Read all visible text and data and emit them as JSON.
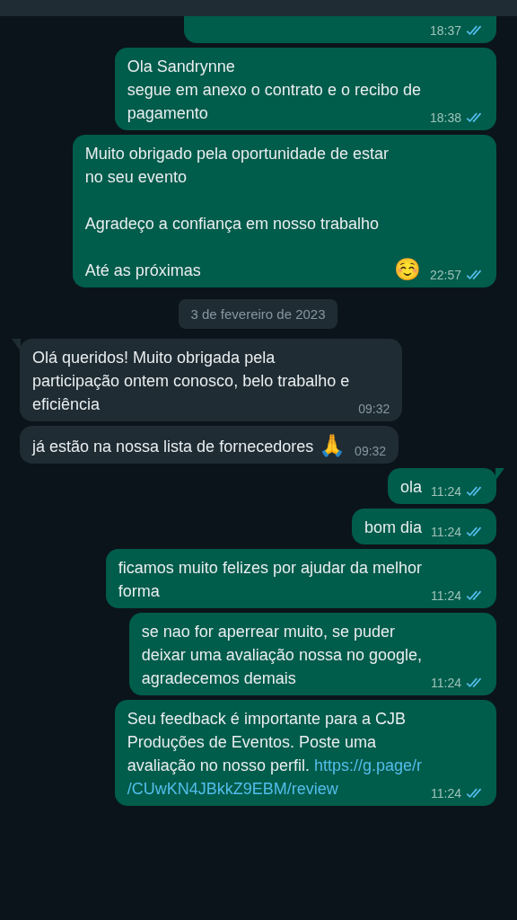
{
  "messages": [
    {
      "kind": "out",
      "time": "18:37",
      "read": true,
      "tail": false,
      "clipped": true
    },
    {
      "kind": "out",
      "text": "Ola Sandrynne\nsegue em anexo o contrato e o recibo de\npagamento",
      "time": "18:38",
      "read": true,
      "tail": false
    },
    {
      "kind": "out",
      "text": "Muito obrigado pela oportunidade de estar\nno seu evento\n\nAgradeço a confiança em nosso trabalho\n\nAté as próximas",
      "emoji": "☺️",
      "time": "22:57",
      "read": true,
      "tail": false
    },
    {
      "kind": "date",
      "text": "3 de fevereiro de 2023"
    },
    {
      "kind": "in",
      "text": "Olá queridos! Muito obrigada pela\nparticipação ontem conosco, belo trabalho e\neficiência",
      "time": "09:32",
      "tail": true
    },
    {
      "kind": "in",
      "text": "já estão na nossa lista de fornecedores",
      "emoji": "🙏",
      "time": "09:32",
      "tail": false
    },
    {
      "kind": "out",
      "text": "ola",
      "time": "11:24",
      "read": true,
      "tail": true
    },
    {
      "kind": "out",
      "text": "bom dia",
      "time": "11:24",
      "read": true,
      "tail": false
    },
    {
      "kind": "out",
      "text": "ficamos muito felizes por ajudar da melhor\nforma",
      "time": "11:24",
      "read": true,
      "tail": false
    },
    {
      "kind": "out",
      "text": "se nao for aperrear muito, se puder\ndeixar uma avaliação nossa no google,\nagradecemos demais",
      "time": "11:24",
      "read": true,
      "tail": false
    },
    {
      "kind": "out",
      "text": "Seu feedback é importante para a CJB\nProduções de Eventos. Poste uma\navaliação no nosso perfil.",
      "link": [
        "https://g.page/r",
        "/CUwKN4JBkkZ9EBM/review"
      ],
      "time": "11:24",
      "read": true,
      "tail": false
    }
  ]
}
